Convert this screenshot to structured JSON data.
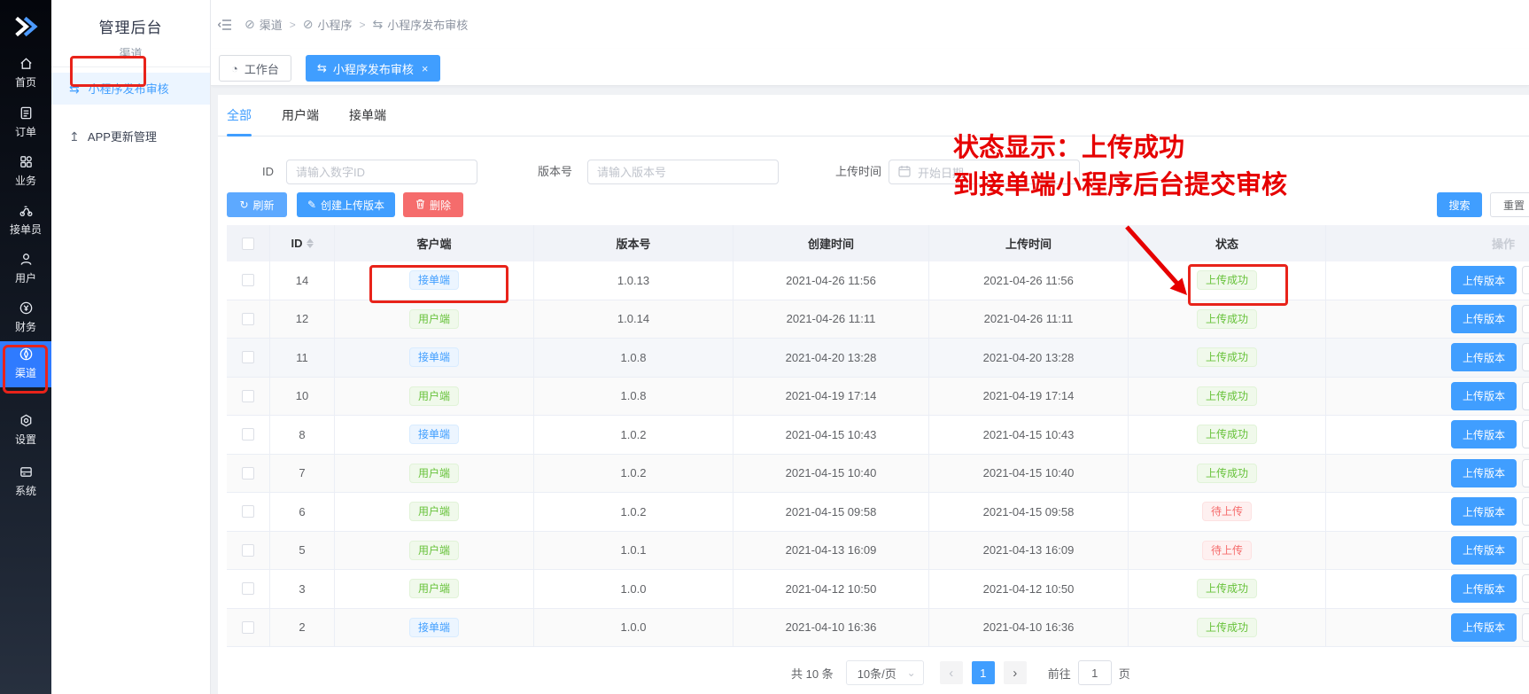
{
  "sidebar": {
    "items": [
      {
        "label": "首页",
        "icon": "home-icon"
      },
      {
        "label": "订单",
        "icon": "orders-icon"
      },
      {
        "label": "业务",
        "icon": "business-icon"
      },
      {
        "label": "接单员",
        "icon": "courier-icon"
      },
      {
        "label": "用户",
        "icon": "users-icon"
      },
      {
        "label": "财务",
        "icon": "finance-icon"
      },
      {
        "label": "渠道",
        "icon": "channel-icon",
        "active": true
      },
      {
        "label": "设置",
        "icon": "settings-icon"
      },
      {
        "label": "系统",
        "icon": "system-icon"
      }
    ]
  },
  "submenu": {
    "title": "管理后台",
    "subtitle": "渠道",
    "items": [
      {
        "label": "小程序发布审核",
        "active": true
      },
      {
        "label": "APP更新管理",
        "active": false
      }
    ]
  },
  "breadcrumb": {
    "separator": ">",
    "items": [
      "渠道",
      "小程序",
      "小程序发布审核"
    ]
  },
  "tagbar": {
    "workbench": "工作台",
    "active_tab": "小程序发布审核",
    "close_glyph": "×"
  },
  "tabs": {
    "all": "全部",
    "user_client": "用户端",
    "receiver_client": "接单端"
  },
  "filters": {
    "id_label": "ID",
    "id_placeholder": "请输入数字ID",
    "version_label": "版本号",
    "version_placeholder": "请输入版本号",
    "upload_time_label": "上传时间",
    "date_placeholder": "开始日期"
  },
  "toolbar": {
    "refresh": "刷新",
    "create_upload": "创建上传版本",
    "delete": "删除",
    "search": "搜索",
    "reset": "重置"
  },
  "annotation": {
    "line1": "状态显示：上传成功",
    "line2": "到接单端小程序后台提交审核"
  },
  "table": {
    "headers": {
      "id": "ID",
      "client": "客户端",
      "version": "版本号",
      "created": "创建时间",
      "uploaded": "上传时间",
      "status": "状态",
      "operation": "操作"
    },
    "row_action": "上传版本",
    "rows": [
      {
        "id": "14",
        "client": "接单端",
        "version": "1.0.13",
        "created": "2021-04-26 11:56",
        "uploaded": "2021-04-26 11:56",
        "status": "上传成功"
      },
      {
        "id": "12",
        "client": "用户端",
        "version": "1.0.14",
        "created": "2021-04-26 11:11",
        "uploaded": "2021-04-26 11:11",
        "status": "上传成功"
      },
      {
        "id": "11",
        "client": "接单端",
        "version": "1.0.8",
        "created": "2021-04-20 13:28",
        "uploaded": "2021-04-20 13:28",
        "status": "上传成功"
      },
      {
        "id": "10",
        "client": "用户端",
        "version": "1.0.8",
        "created": "2021-04-19 17:14",
        "uploaded": "2021-04-19 17:14",
        "status": "上传成功"
      },
      {
        "id": "8",
        "client": "接单端",
        "version": "1.0.2",
        "created": "2021-04-15 10:43",
        "uploaded": "2021-04-15 10:43",
        "status": "上传成功"
      },
      {
        "id": "7",
        "client": "用户端",
        "version": "1.0.2",
        "created": "2021-04-15 10:40",
        "uploaded": "2021-04-15 10:40",
        "status": "上传成功"
      },
      {
        "id": "6",
        "client": "用户端",
        "version": "1.0.2",
        "created": "2021-04-15 09:58",
        "uploaded": "2021-04-15 09:58",
        "status": "待上传"
      },
      {
        "id": "5",
        "client": "用户端",
        "version": "1.0.1",
        "created": "2021-04-13 16:09",
        "uploaded": "2021-04-13 16:09",
        "status": "待上传"
      },
      {
        "id": "3",
        "client": "用户端",
        "version": "1.0.0",
        "created": "2021-04-12 10:50",
        "uploaded": "2021-04-12 10:50",
        "status": "上传成功"
      },
      {
        "id": "2",
        "client": "接单端",
        "version": "1.0.0",
        "created": "2021-04-10 16:36",
        "uploaded": "2021-04-10 16:36",
        "status": "上传成功"
      }
    ]
  },
  "pagination": {
    "total": "共 10 条",
    "page_size": "10条/页",
    "prev_glyph": "‹",
    "next_glyph": "›",
    "current_page": "1",
    "goto_label": "前往",
    "goto_value": "1",
    "page_unit": "页"
  },
  "glyphs": {
    "swap": "⇆",
    "upload": "↥",
    "refresh": "↻",
    "edit": "✎",
    "gauge": "◔",
    "chevron_down": "⌄",
    "crumb_circle": "⊘"
  },
  "colors": {
    "primary": "#409eff",
    "success": "#67c23a",
    "danger": "#f56c6c",
    "annotation_red": "#e60000"
  }
}
